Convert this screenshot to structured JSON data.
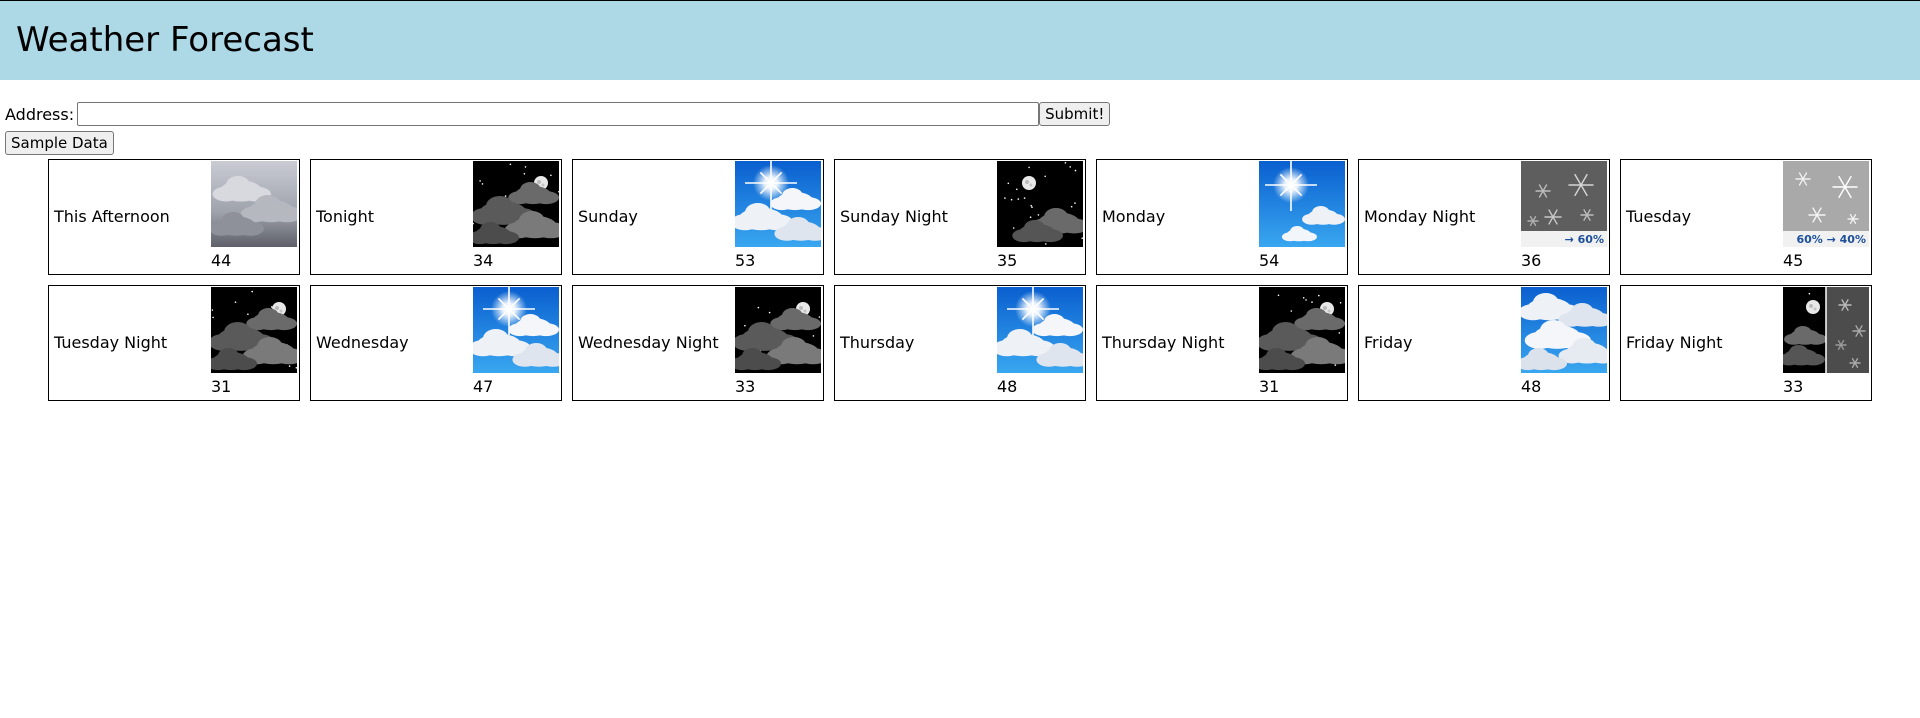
{
  "header": {
    "title": "Weather Forecast"
  },
  "form": {
    "address_label": "Address:",
    "address_value": "",
    "submit_label": "Submit!",
    "sample_label": "Sample Data"
  },
  "forecast": [
    {
      "name": "This Afternoon",
      "temp": "44",
      "icon": "overcast-icon",
      "caption": ""
    },
    {
      "name": "Tonight",
      "temp": "34",
      "icon": "night-cloudy-icon",
      "caption": ""
    },
    {
      "name": "Sunday",
      "temp": "53",
      "icon": "partly-sunny-icon",
      "caption": ""
    },
    {
      "name": "Sunday Night",
      "temp": "35",
      "icon": "night-partly-cloudy-icon",
      "caption": ""
    },
    {
      "name": "Monday",
      "temp": "54",
      "icon": "sunny-icon",
      "caption": ""
    },
    {
      "name": "Monday Night",
      "temp": "36",
      "icon": "snow-icon",
      "caption": "→ 60%"
    },
    {
      "name": "Tuesday",
      "temp": "45",
      "icon": "snow-light-icon",
      "caption": "60% → 40%"
    },
    {
      "name": "Tuesday Night",
      "temp": "31",
      "icon": "night-cloudy-icon",
      "caption": ""
    },
    {
      "name": "Wednesday",
      "temp": "47",
      "icon": "partly-sunny-icon",
      "caption": ""
    },
    {
      "name": "Wednesday Night",
      "temp": "33",
      "icon": "night-cloudy-icon",
      "caption": ""
    },
    {
      "name": "Thursday",
      "temp": "48",
      "icon": "partly-sunny-icon",
      "caption": ""
    },
    {
      "name": "Thursday Night",
      "temp": "31",
      "icon": "night-cloudy-icon",
      "caption": ""
    },
    {
      "name": "Friday",
      "temp": "48",
      "icon": "mostly-cloudy-day-icon",
      "caption": ""
    },
    {
      "name": "Friday Night",
      "temp": "33",
      "icon": "night-snow-split-icon",
      "caption": ""
    }
  ]
}
